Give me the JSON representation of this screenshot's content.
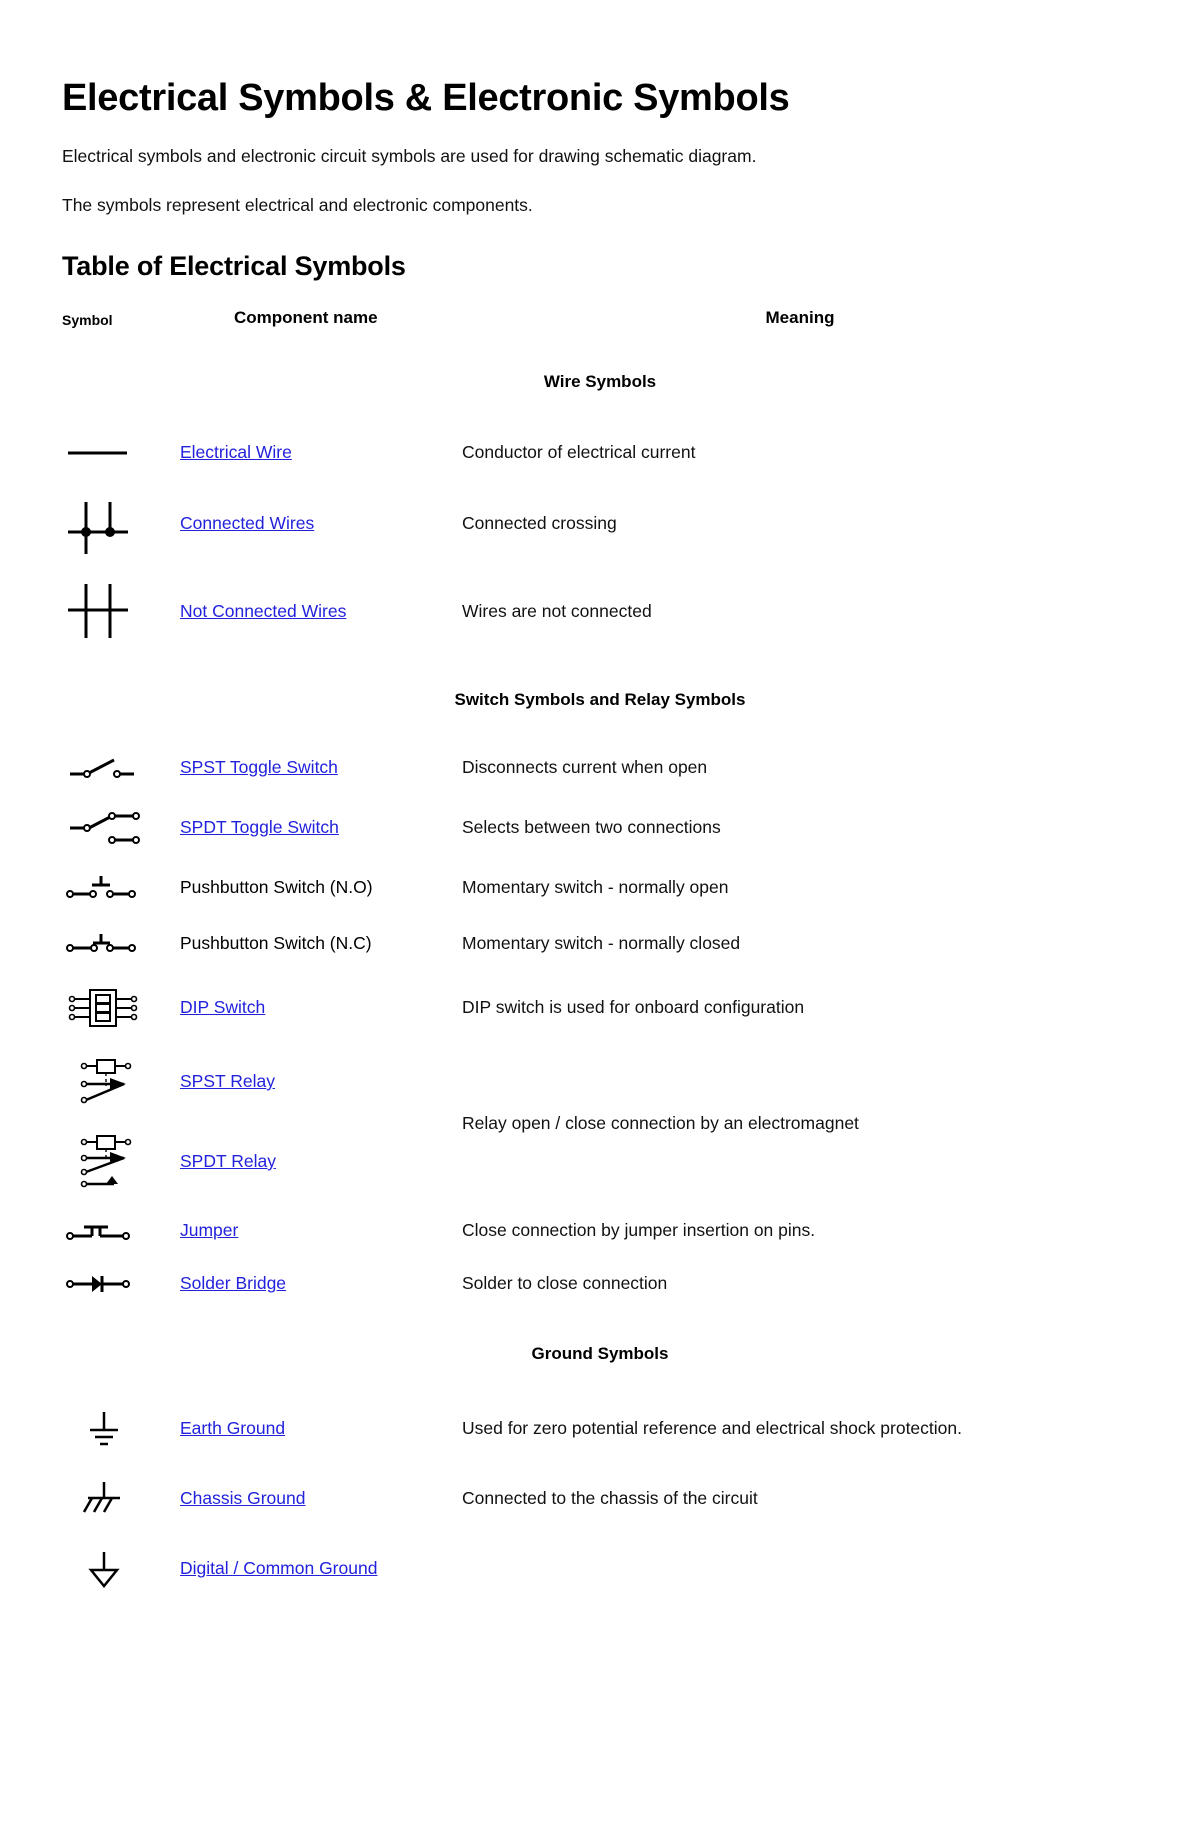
{
  "page": {
    "title": "Electrical Symbols & Electronic Symbols",
    "intro_1": "Electrical symbols and electronic circuit symbols are used for drawing schematic diagram.",
    "intro_2": "The symbols represent electrical and electronic components.",
    "section_title": "Table of Electrical Symbols"
  },
  "table": {
    "headers": {
      "symbol": "Symbol",
      "component_name": "Component name",
      "meaning": "Meaning"
    },
    "groups": [
      {
        "group_label": "Wire Symbols",
        "rows": [
          {
            "symbol_icon": "electrical-wire-symbol",
            "name": "Electrical Wire",
            "is_link": true,
            "meaning": "Conductor of electrical current"
          },
          {
            "symbol_icon": "connected-wires-symbol",
            "name": "Connected Wires",
            "is_link": true,
            "meaning": "Connected crossing"
          },
          {
            "symbol_icon": "not-connected-wires-symbol",
            "name": "Not Connected Wires",
            "is_link": true,
            "meaning": "Wires are not connected"
          }
        ]
      },
      {
        "group_label": "Switch Symbols and Relay Symbols",
        "rows": [
          {
            "symbol_icon": "spst-toggle-switch-symbol",
            "name": "SPST Toggle Switch",
            "is_link": true,
            "meaning": "Disconnects current when open"
          },
          {
            "symbol_icon": "spdt-toggle-switch-symbol",
            "name": "SPDT Toggle Switch",
            "is_link": true,
            "meaning": "Selects between two connections"
          },
          {
            "symbol_icon": "pushbutton-no-symbol",
            "name": "Pushbutton Switch (N.O)",
            "is_link": false,
            "meaning": "Momentary switch - normally open"
          },
          {
            "symbol_icon": "pushbutton-nc-symbol",
            "name": "Pushbutton Switch (N.C)",
            "is_link": false,
            "meaning": "Momentary switch - normally closed"
          },
          {
            "symbol_icon": "dip-switch-symbol",
            "name": "DIP Switch",
            "is_link": true,
            "meaning": "DIP switch is used for onboard configuration"
          },
          {
            "symbol_icon": "spst-relay-symbol",
            "name": "SPST Relay",
            "is_link": true,
            "meaning": ""
          },
          {
            "symbol_icon": "spdt-relay-symbol",
            "name": "SPDT Relay",
            "is_link": true,
            "meaning": "Relay open / close connection by an electromagnet"
          },
          {
            "symbol_icon": "jumper-symbol",
            "name": "Jumper",
            "is_link": true,
            "meaning": "Close connection by jumper insertion on pins."
          },
          {
            "symbol_icon": "solder-bridge-symbol",
            "name": "Solder Bridge",
            "is_link": true,
            "meaning": "Solder to close connection"
          }
        ]
      },
      {
        "group_label": "Ground Symbols",
        "rows": [
          {
            "symbol_icon": "earth-ground-symbol",
            "name": "Earth Ground",
            "is_link": true,
            "meaning": "Used for zero potential reference and electrical shock protection."
          },
          {
            "symbol_icon": "chassis-ground-symbol",
            "name": "Chassis Ground",
            "is_link": true,
            "meaning": "Connected to the chassis of the circuit"
          },
          {
            "symbol_icon": "digital-common-ground-symbol",
            "name": "Digital / Common Ground",
            "is_link": true,
            "meaning": ""
          }
        ]
      }
    ]
  },
  "colors": {
    "link": "#2222dd",
    "text": "#000000",
    "background": "#ffffff"
  }
}
